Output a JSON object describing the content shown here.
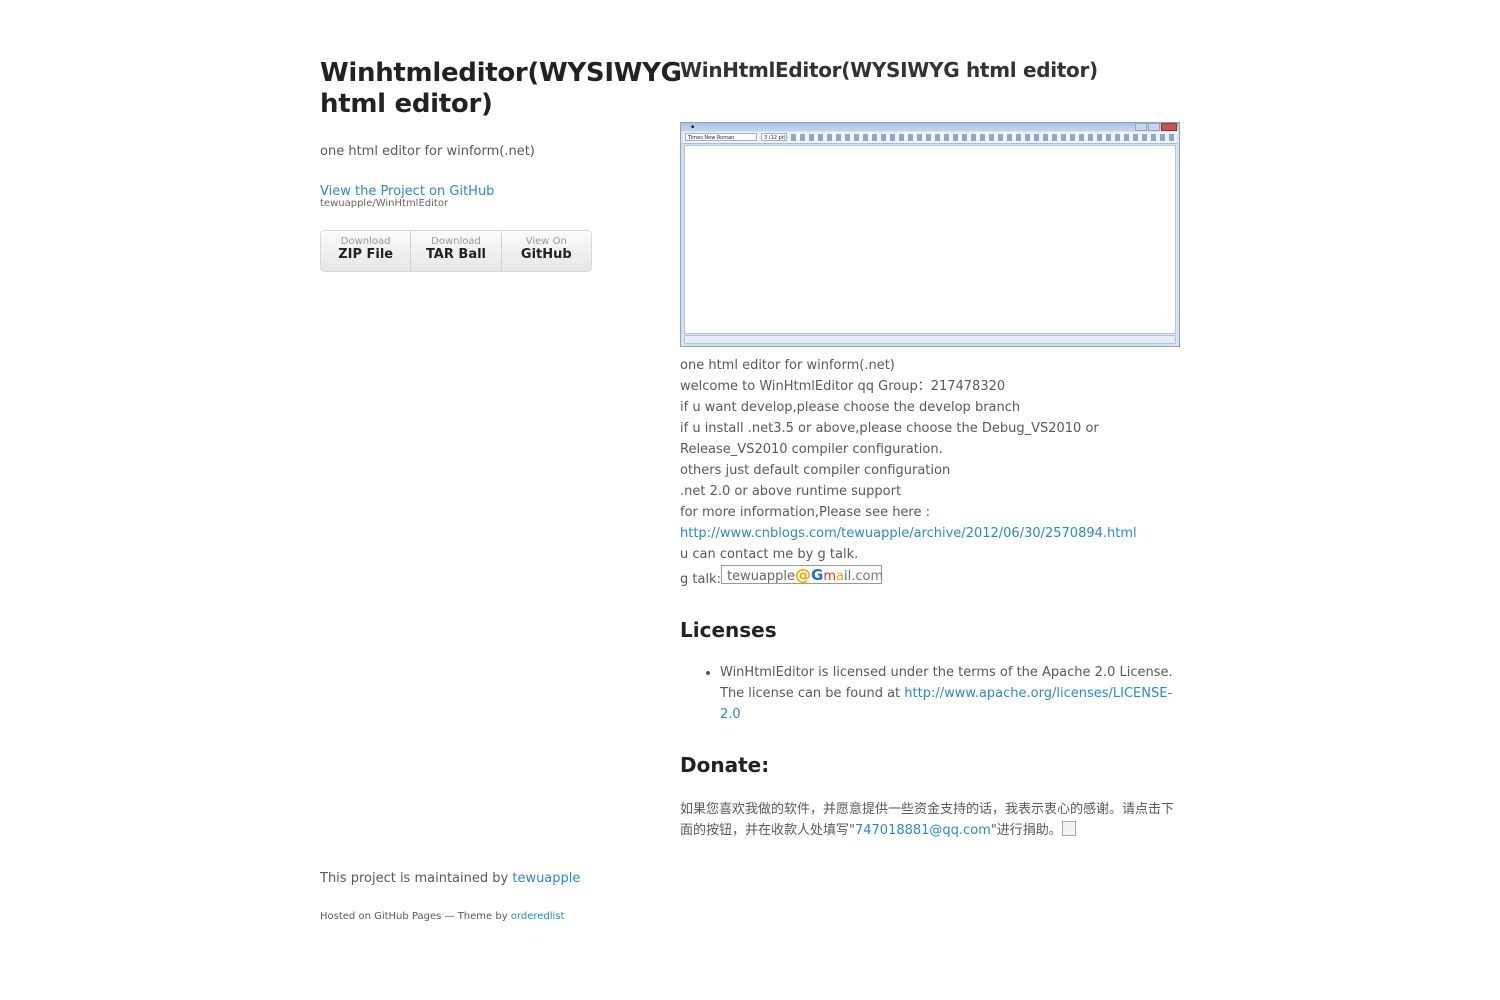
{
  "header": {
    "title": "Winhtmleditor(WYSIWYG html editor)",
    "tagline": "one html editor for winform(.net)",
    "github_link": "View the Project on GitHub",
    "github_sub": "tewuapple/WinHtmlEditor",
    "downloads": [
      {
        "small": "Download",
        "big": "ZIP File"
      },
      {
        "small": "Download",
        "big": "TAR Ball"
      },
      {
        "small": "View On",
        "big": "GitHub"
      }
    ]
  },
  "main": {
    "page_title": "WinHtmlEditor(WYSIWYG html editor)",
    "screenshot": {
      "font": "Times New Roman",
      "size": "3 (12 pt)"
    },
    "lines": [
      "one html editor for winform(.net)",
      "welcome to WinHtmlEditor qq Group：217478320",
      "if u want develop,please choose the develop branch",
      "if u install .net3.5 or above,please choose the Debug_VS2010 or Release_VS2010 compiler configuration.",
      "others just default compiler configuration",
      ".net 2.0 or above runtime support",
      "for more information,Please see here :"
    ],
    "info_link": "http://www.cnblogs.com/tewuapple/archive/2012/06/30/2570894.html",
    "contact_line": "u can contact me by g talk.",
    "gtalk_label": "g talk:",
    "gmail_badge": {
      "user": "tewuapple",
      "at": "@",
      "g": "G",
      "m": "m",
      "a": "a",
      "i": "i",
      "l": "l",
      "domain": ".com"
    },
    "licenses_heading": "Licenses",
    "license_text": "WinHtmlEditor is licensed under the terms of the Apache 2.0 License. The license can be found at",
    "license_link": "http://www.apache.org/licenses/LICENSE-2.0",
    "donate_heading": "Donate:",
    "donate_text_before": "如果您喜欢我做的软件，并愿意提供一些资金支持的话，我表示衷心的感谢。请点击下面的按钮，并在收款人处填写\"",
    "donate_email": "747018881@qq.com",
    "donate_text_after": "\"进行捐助。"
  },
  "footer": {
    "maintained_prefix": "This project is maintained by",
    "maintainer": "tewuapple",
    "hosted_prefix": "Hosted on GitHub Pages — Theme by",
    "theme_author": "orderedlist"
  },
  "colors": {
    "link": "#2a89c9",
    "text": "#595959",
    "heading": "#222222"
  }
}
